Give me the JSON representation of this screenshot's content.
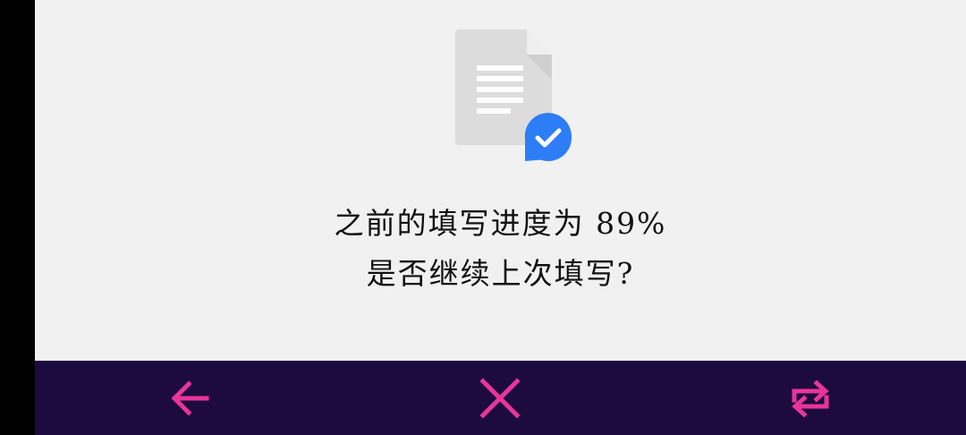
{
  "dialog": {
    "progress_line": "之前的填写进度为 89%",
    "question_line": "是否继续上次填写?"
  },
  "icons": {
    "illustration": "document-check-icon",
    "back": "arrow-left-icon",
    "close": "close-icon",
    "redo": "repeat-icon"
  },
  "colors": {
    "content_bg": "#f1f1f1",
    "bottom_bar_bg": "#1d0b40",
    "accent_pink": "#e8359a",
    "check_badge_blue": "#2d7df6",
    "doc_gray": "#dcdcdc"
  }
}
